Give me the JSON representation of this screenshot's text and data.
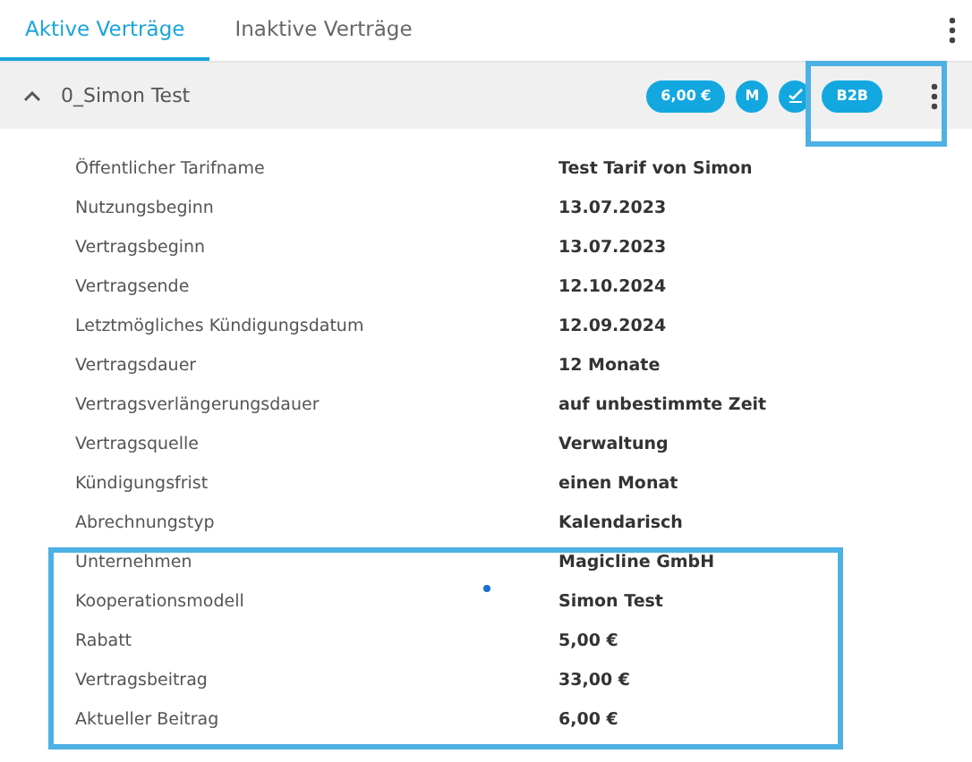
{
  "tabs": [
    {
      "label": "Aktive Verträge",
      "selected": true
    },
    {
      "label": "Inaktive Verträge",
      "selected": false
    }
  ],
  "contract": {
    "title": "0_Simon Test",
    "expanded": true,
    "badges": [
      {
        "kind": "text",
        "label": "6,00 €"
      },
      {
        "kind": "text",
        "label": "M"
      },
      {
        "kind": "icon"
      },
      {
        "kind": "text",
        "label": "B2B"
      }
    ],
    "details": [
      {
        "label": "Öffentlicher Tarifname",
        "value": "Test Tarif von Simon"
      },
      {
        "label": "Nutzungsbeginn",
        "value": "13.07.2023"
      },
      {
        "label": "Vertragsbeginn",
        "value": "13.07.2023"
      },
      {
        "label": "Vertragsende",
        "value": "12.10.2024"
      },
      {
        "label": "Letztmögliches Kündigungsdatum",
        "value": "12.09.2024"
      },
      {
        "label": "Vertragsdauer",
        "value": "12 Monate"
      },
      {
        "label": "Vertragsverlängerungsdauer",
        "value": "auf unbestimmte Zeit"
      },
      {
        "label": "Vertragsquelle",
        "value": "Verwaltung"
      },
      {
        "label": "Kündigungsfrist",
        "value": "einen Monat"
      },
      {
        "label": "Abrechnungstyp",
        "value": "Kalendarisch"
      },
      {
        "label": "Unternehmen",
        "value": "Magicline GmbH"
      },
      {
        "label": "Kooperationsmodell",
        "value": "Simon Test"
      },
      {
        "label": "Rabatt",
        "value": "5,00 €"
      },
      {
        "label": "Vertragsbeitrag",
        "value": "33,00 €"
      },
      {
        "label": "Aktueller Beitrag",
        "value": "6,00 €"
      }
    ]
  }
}
